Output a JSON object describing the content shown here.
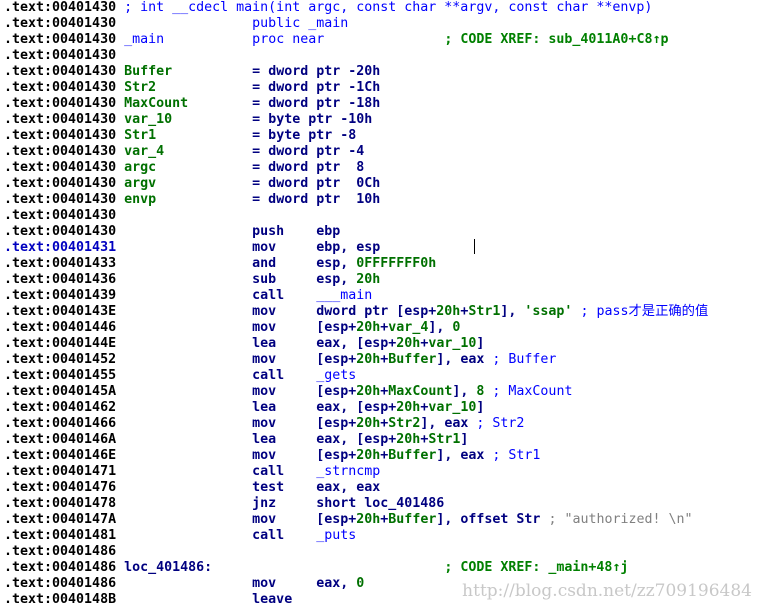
{
  "colors": {
    "address": "#000000",
    "keyword": "#000080",
    "name": "#007000",
    "label": "#0000ff",
    "comment": "#008000",
    "string": "#808080"
  },
  "watermark": "http://blog.csdn.net/zz709196484",
  "lines": [
    {
      "addr": ".text:00401430",
      "segs": [
        {
          "t": " ; int __cdecl main(int argc, const char **argv, const char **envp)",
          "c": "b"
        }
      ]
    },
    {
      "addr": ".text:00401430",
      "segs": [
        {
          "t": "                 public _main",
          "c": "b"
        }
      ]
    },
    {
      "addr": ".text:00401430",
      "segs": [
        {
          "t": " _main",
          "c": "b"
        },
        {
          "t": "           proc near",
          "c": "b"
        },
        {
          "t": "               ; CODE XREF: sub_4011A0+C8↑p",
          "c": "c"
        }
      ]
    },
    {
      "addr": ".text:00401430",
      "segs": []
    },
    {
      "addr": ".text:00401430",
      "segs": [
        {
          "t": " Buffer",
          "c": "g"
        },
        {
          "t": "          = dword ptr -20h",
          "c": "k"
        }
      ]
    },
    {
      "addr": ".text:00401430",
      "segs": [
        {
          "t": " Str2",
          "c": "g"
        },
        {
          "t": "            = dword ptr -1Ch",
          "c": "k"
        }
      ]
    },
    {
      "addr": ".text:00401430",
      "segs": [
        {
          "t": " MaxCount",
          "c": "g"
        },
        {
          "t": "        = dword ptr -18h",
          "c": "k"
        }
      ]
    },
    {
      "addr": ".text:00401430",
      "segs": [
        {
          "t": " var_10",
          "c": "g"
        },
        {
          "t": "          = byte ptr -10h",
          "c": "k"
        }
      ]
    },
    {
      "addr": ".text:00401430",
      "segs": [
        {
          "t": " Str1",
          "c": "g"
        },
        {
          "t": "            = byte ptr -8",
          "c": "k"
        }
      ]
    },
    {
      "addr": ".text:00401430",
      "segs": [
        {
          "t": " var_4",
          "c": "g"
        },
        {
          "t": "           = dword ptr -4",
          "c": "k"
        }
      ]
    },
    {
      "addr": ".text:00401430",
      "segs": [
        {
          "t": " argc",
          "c": "g"
        },
        {
          "t": "            = dword ptr  8",
          "c": "k"
        }
      ]
    },
    {
      "addr": ".text:00401430",
      "segs": [
        {
          "t": " argv",
          "c": "g"
        },
        {
          "t": "            = dword ptr  0Ch",
          "c": "k"
        }
      ]
    },
    {
      "addr": ".text:00401430",
      "segs": [
        {
          "t": " envp",
          "c": "g"
        },
        {
          "t": "            = dword ptr  10h",
          "c": "k"
        }
      ]
    },
    {
      "addr": ".text:00401430",
      "segs": []
    },
    {
      "addr": ".text:00401430",
      "segs": [
        {
          "t": "                 push    ebp",
          "c": "k"
        }
      ]
    },
    {
      "addr": ".text:00401431",
      "cur": true,
      "segs": [
        {
          "t": "                 mov     ebp, esp",
          "c": "k"
        }
      ]
    },
    {
      "addr": ".text:00401433",
      "segs": [
        {
          "t": "                 and     esp, ",
          "c": "k"
        },
        {
          "t": "0FFFFFFF0h",
          "c": "n"
        }
      ]
    },
    {
      "addr": ".text:00401436",
      "segs": [
        {
          "t": "                 sub     esp, ",
          "c": "k"
        },
        {
          "t": "20h",
          "c": "n"
        }
      ]
    },
    {
      "addr": ".text:00401439",
      "segs": [
        {
          "t": "                 call    ",
          "c": "k"
        },
        {
          "t": "___main",
          "c": "b"
        }
      ]
    },
    {
      "addr": ".text:0040143E",
      "segs": [
        {
          "t": "                 mov     dword ptr [esp+",
          "c": "k"
        },
        {
          "t": "20h",
          "c": "n"
        },
        {
          "t": "+",
          "c": "k"
        },
        {
          "t": "Str1",
          "c": "g"
        },
        {
          "t": "], ",
          "c": "k"
        },
        {
          "t": "'ssap'",
          "c": "n"
        },
        {
          "t": " ; pass才是正确的值",
          "c": "b"
        }
      ]
    },
    {
      "addr": ".text:00401446",
      "segs": [
        {
          "t": "                 mov     [esp+",
          "c": "k"
        },
        {
          "t": "20h",
          "c": "n"
        },
        {
          "t": "+",
          "c": "k"
        },
        {
          "t": "var_4",
          "c": "g"
        },
        {
          "t": "], ",
          "c": "k"
        },
        {
          "t": "0",
          "c": "n"
        }
      ]
    },
    {
      "addr": ".text:0040144E",
      "segs": [
        {
          "t": "                 lea     eax, [esp+",
          "c": "k"
        },
        {
          "t": "20h",
          "c": "n"
        },
        {
          "t": "+",
          "c": "k"
        },
        {
          "t": "var_10",
          "c": "g"
        },
        {
          "t": "]",
          "c": "k"
        }
      ]
    },
    {
      "addr": ".text:00401452",
      "segs": [
        {
          "t": "                 mov     [esp+",
          "c": "k"
        },
        {
          "t": "20h",
          "c": "n"
        },
        {
          "t": "+",
          "c": "k"
        },
        {
          "t": "Buffer",
          "c": "g"
        },
        {
          "t": "], eax",
          "c": "k"
        },
        {
          "t": " ; Buffer",
          "c": "b"
        }
      ]
    },
    {
      "addr": ".text:00401455",
      "segs": [
        {
          "t": "                 call    ",
          "c": "k"
        },
        {
          "t": "_gets",
          "c": "b"
        }
      ]
    },
    {
      "addr": ".text:0040145A",
      "segs": [
        {
          "t": "                 mov     [esp+",
          "c": "k"
        },
        {
          "t": "20h",
          "c": "n"
        },
        {
          "t": "+",
          "c": "k"
        },
        {
          "t": "MaxCount",
          "c": "g"
        },
        {
          "t": "], ",
          "c": "k"
        },
        {
          "t": "8",
          "c": "n"
        },
        {
          "t": " ; MaxCount",
          "c": "b"
        }
      ]
    },
    {
      "addr": ".text:00401462",
      "segs": [
        {
          "t": "                 lea     eax, [esp+",
          "c": "k"
        },
        {
          "t": "20h",
          "c": "n"
        },
        {
          "t": "+",
          "c": "k"
        },
        {
          "t": "var_10",
          "c": "g"
        },
        {
          "t": "]",
          "c": "k"
        }
      ]
    },
    {
      "addr": ".text:00401466",
      "segs": [
        {
          "t": "                 mov     [esp+",
          "c": "k"
        },
        {
          "t": "20h",
          "c": "n"
        },
        {
          "t": "+",
          "c": "k"
        },
        {
          "t": "Str2",
          "c": "g"
        },
        {
          "t": "], eax",
          "c": "k"
        },
        {
          "t": " ; Str2",
          "c": "b"
        }
      ]
    },
    {
      "addr": ".text:0040146A",
      "segs": [
        {
          "t": "                 lea     eax, [esp+",
          "c": "k"
        },
        {
          "t": "20h",
          "c": "n"
        },
        {
          "t": "+",
          "c": "k"
        },
        {
          "t": "Str1",
          "c": "g"
        },
        {
          "t": "]",
          "c": "k"
        }
      ]
    },
    {
      "addr": ".text:0040146E",
      "segs": [
        {
          "t": "                 mov     [esp+",
          "c": "k"
        },
        {
          "t": "20h",
          "c": "n"
        },
        {
          "t": "+",
          "c": "k"
        },
        {
          "t": "Buffer",
          "c": "g"
        },
        {
          "t": "], eax",
          "c": "k"
        },
        {
          "t": " ; Str1",
          "c": "b"
        }
      ]
    },
    {
      "addr": ".text:00401471",
      "segs": [
        {
          "t": "                 call    ",
          "c": "k"
        },
        {
          "t": "_strncmp",
          "c": "b"
        }
      ]
    },
    {
      "addr": ".text:00401476",
      "segs": [
        {
          "t": "                 test    eax, eax",
          "c": "k"
        }
      ]
    },
    {
      "addr": ".text:00401478",
      "segs": [
        {
          "t": "                 jnz     short ",
          "c": "k"
        },
        {
          "t": "loc_401486",
          "c": "k"
        }
      ]
    },
    {
      "addr": ".text:0040147A",
      "segs": [
        {
          "t": "                 mov     [esp+",
          "c": "k"
        },
        {
          "t": "20h",
          "c": "n"
        },
        {
          "t": "+",
          "c": "k"
        },
        {
          "t": "Buffer",
          "c": "g"
        },
        {
          "t": "], offset ",
          "c": "k"
        },
        {
          "t": "Str",
          "c": "k"
        },
        {
          "t": " ; \"authorized! \\n\"",
          "c": "s"
        }
      ]
    },
    {
      "addr": ".text:00401481",
      "segs": [
        {
          "t": "                 call    ",
          "c": "k"
        },
        {
          "t": "_puts",
          "c": "b"
        }
      ]
    },
    {
      "addr": ".text:00401486",
      "segs": []
    },
    {
      "addr": ".text:00401486",
      "segs": [
        {
          "t": " loc_401486:",
          "c": "k"
        },
        {
          "t": "                             ; CODE XREF: _main+48↑j",
          "c": "c"
        }
      ]
    },
    {
      "addr": ".text:00401486",
      "segs": [
        {
          "t": "                 mov     eax, ",
          "c": "k"
        },
        {
          "t": "0",
          "c": "n"
        }
      ]
    },
    {
      "addr": ".text:0040148B",
      "segs": [
        {
          "t": "                 leave",
          "c": "k"
        }
      ]
    }
  ]
}
